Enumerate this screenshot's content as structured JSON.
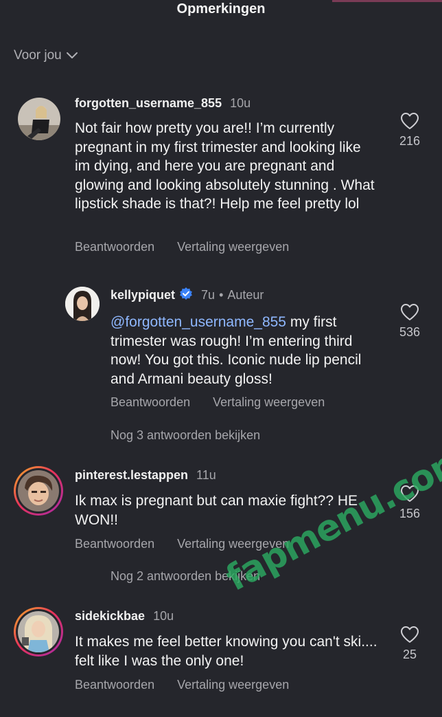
{
  "header": {
    "title": "Opmerkingen"
  },
  "filter": {
    "label": "Voor jou",
    "icon": "chevron-down-icon"
  },
  "comments": [
    {
      "username": "forgotten_username_855",
      "time": "10u",
      "text": "Not fair how pretty you are!! I’m currently pregnant in my first trimester and looking like im dying, and here you are pregnant and glowing and looking absolutely stunning . What lipstick shade is that?! Help me feel pretty lol",
      "likes": "216",
      "reply_label": "Beantwoorden",
      "translate_label": "Vertaling weergeven"
    },
    {
      "username": "kellypiquet",
      "verified": true,
      "time": "7u",
      "author_label": "Auteur",
      "mention": "@forgotten_username_855",
      "text": " my first trimester was rough! I’m entering third now! You got this. Iconic nude lip pencil and Armani beauty gloss!",
      "likes": "536",
      "reply_label": "Beantwoorden",
      "translate_label": "Vertaling weergeven",
      "more_replies": "Nog 3 antwoorden bekijken"
    },
    {
      "username": "pinterest.lestappen",
      "time": "11u",
      "text": "Ik max is pregnant but can maxie fight?? HE WON!!",
      "likes": "156",
      "reply_label": "Beantwoorden",
      "translate_label": "Vertaling weergeven",
      "more_replies": "Nog 2 antwoorden bekijken"
    },
    {
      "username": "sidekickbae",
      "time": "10u",
      "text": "It makes me feel better knowing you can't ski.... felt like I was the only one!",
      "likes": "25",
      "reply_label": "Beantwoorden",
      "translate_label": "Vertaling weergeven"
    }
  ],
  "watermark": "fapmenu.com",
  "colors": {
    "background": "#25262c",
    "secondary_text": "#a6a6ab",
    "mention": "#8fb8ff",
    "verified": "#3b82f6",
    "watermark": "#2caa60"
  }
}
